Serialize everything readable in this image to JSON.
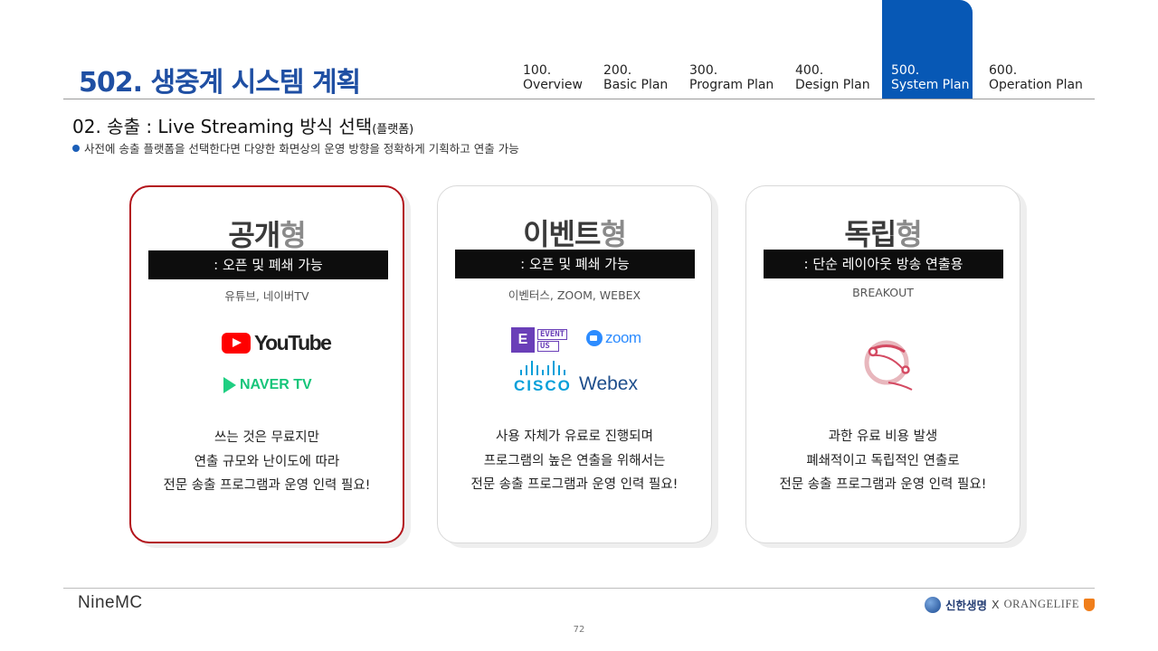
{
  "header": {
    "page_title": "502. 생중계 시스템 계획",
    "nav_tabs": [
      {
        "num": "100.",
        "name": "Overview",
        "active": false
      },
      {
        "num": "200.",
        "name": "Basic Plan",
        "active": false
      },
      {
        "num": "300.",
        "name": "Program Plan",
        "active": false
      },
      {
        "num": "400.",
        "name": "Design Plan",
        "active": false
      },
      {
        "num": "500.",
        "name": "System Plan",
        "active": true
      },
      {
        "num": "600.",
        "name": "Operation Plan",
        "active": false
      }
    ]
  },
  "section": {
    "title": "02. 송출 : Live Streaming 방식 선택",
    "title_suffix": "(플랫폼)",
    "bullet": "사전에 송출 플랫폼을 선택한다면 다양한 화면상의 운영 방향을 정확하게 기획하고 연출 가능"
  },
  "cards": [
    {
      "title_main": "공개",
      "title_accent": "형",
      "bar_text": ": 오픈 및 폐쇄 가능",
      "platforms": "유튜브, 네이버TV",
      "logos": {
        "youtube": "YouTube",
        "naver": "NAVER TV"
      },
      "description": [
        "쓰는 것은 무료지만",
        "연출 규모와 난이도에 따라",
        "전문 송출 프로그램과 운영 인력 필요!"
      ],
      "highlighted": true
    },
    {
      "title_main": "이벤트",
      "title_accent": "형",
      "bar_text": ": 오픈 및 폐쇄 가능",
      "platforms": "이벤터스, ZOOM, WEBEX",
      "logos": {
        "eventus_e": "E",
        "eventus_top": "EVENT",
        "eventus_bottom": "US",
        "zoom": "zoom",
        "cisco": "CISCO",
        "webex": "Webex"
      },
      "description": [
        "사용 자체가 유료로 진행되며",
        "프로그램의 높은 연출을 위해서는",
        "전문 송출 프로그램과 운영 인력 필요!"
      ],
      "highlighted": false
    },
    {
      "title_main": "독립",
      "title_accent": "형",
      "bar_text": ": 단순 레이아웃 방송 연출용",
      "platforms": "BREAKOUT",
      "logos": {
        "breakout_icon": "breakout-icon"
      },
      "description": [
        "과한 유료 비용 발생",
        "폐쇄적이고 독립적인 연출로",
        "전문 송출 프로그램과 운영 인력 필요!"
      ],
      "highlighted": false
    }
  ],
  "footer": {
    "left_logo": "NineMC",
    "right_brand_1": "신한생명",
    "right_sep": "X",
    "right_brand_2": "ORANGELIFE",
    "page_number": "72"
  },
  "colors": {
    "title_blue": "#1f4fa3",
    "active_tab": "#0758b5",
    "highlight_border": "#b3141b",
    "bar_black": "#0d0d0d"
  }
}
